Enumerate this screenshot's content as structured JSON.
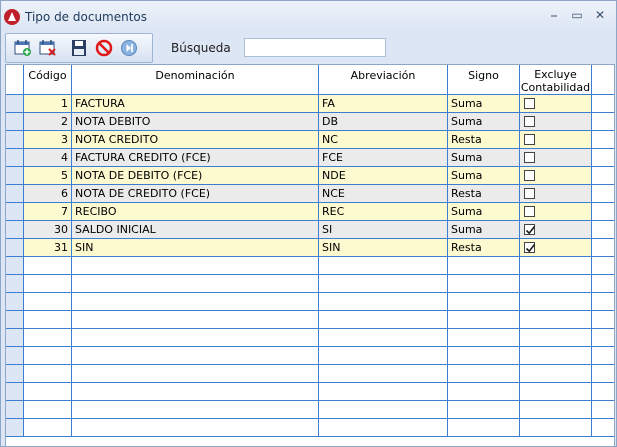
{
  "window": {
    "title": "Tipo de documentos",
    "minimize_label": "⎯",
    "maximize_label": "▭",
    "close_label": "✕"
  },
  "toolbar": {
    "tools": [
      "new-record-icon",
      "delete-record-icon",
      "save-icon",
      "cancel-icon",
      "next-icon"
    ]
  },
  "search": {
    "label": "Búsqueda",
    "value": ""
  },
  "table": {
    "headers": {
      "codigo": "Código",
      "denominacion": "Denominación",
      "abreviacion": "Abreviación",
      "signo": "Signo",
      "excluye": [
        "Excluye",
        "Contabilidad"
      ]
    },
    "rows": [
      {
        "codigo": "1",
        "denominacion": "FACTURA",
        "abreviacion": "FA",
        "signo": "Suma",
        "excluye": false
      },
      {
        "codigo": "2",
        "denominacion": "NOTA DEBITO",
        "abreviacion": "DB",
        "signo": "Suma",
        "excluye": false
      },
      {
        "codigo": "3",
        "denominacion": "NOTA CREDITO",
        "abreviacion": "NC",
        "signo": "Resta",
        "excluye": false
      },
      {
        "codigo": "4",
        "denominacion": "FACTURA CREDITO (FCE)",
        "abreviacion": "FCE",
        "signo": "Suma",
        "excluye": false
      },
      {
        "codigo": "5",
        "denominacion": "NOTA DE DEBITO (FCE)",
        "abreviacion": "NDE",
        "signo": "Suma",
        "excluye": false
      },
      {
        "codigo": "6",
        "denominacion": "NOTA DE CREDITO (FCE)",
        "abreviacion": "NCE",
        "signo": "Resta",
        "excluye": false
      },
      {
        "codigo": "7",
        "denominacion": "RECIBO",
        "abreviacion": "REC",
        "signo": "Suma",
        "excluye": false
      },
      {
        "codigo": "30",
        "denominacion": "SALDO INICIAL",
        "abreviacion": "SI",
        "signo": "Suma",
        "excluye": true
      },
      {
        "codigo": "31",
        "denominacion": "SIN",
        "abreviacion": "SIN",
        "signo": "Resta",
        "excluye": true
      }
    ],
    "empty_rows": 10
  },
  "colors": {
    "row_yellow": "#fdfad0",
    "row_gray": "#ebebeb",
    "grid_line": "#3c7fd0",
    "selector_column": "#dce6f4"
  }
}
